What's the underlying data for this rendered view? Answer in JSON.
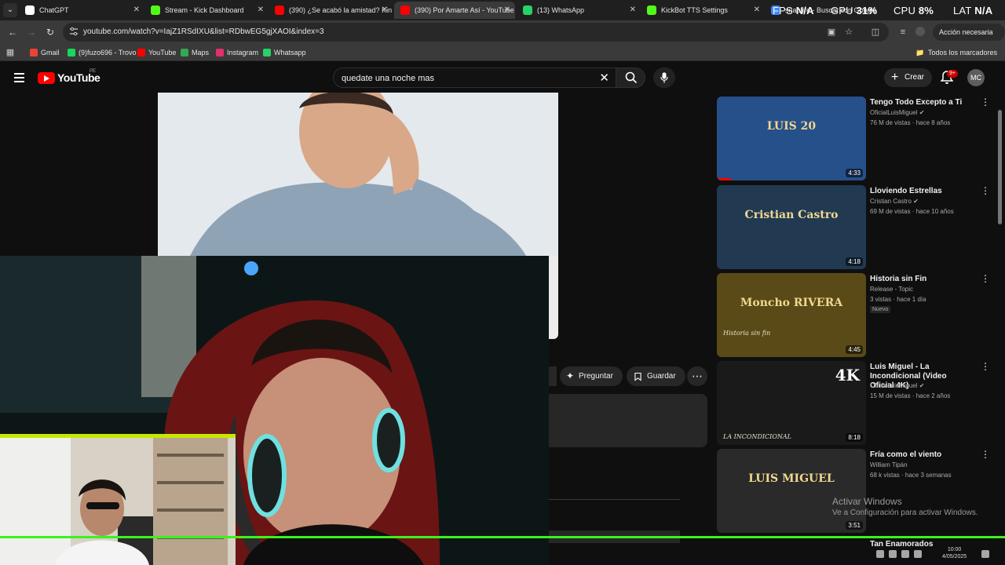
{
  "tabs": [
    {
      "title": "ChatGPT",
      "color": "#ffffff"
    },
    {
      "title": "Stream - Kick Dashboard",
      "color": "#53fc18"
    },
    {
      "title": "(390) ¿Se acabó la amistad? Kin",
      "color": "#ff0000"
    },
    {
      "title": "(390) Por Amarte Así - YouTube",
      "color": "#ff0000",
      "active": true
    },
    {
      "title": "(13) WhatsApp",
      "color": "#25d366"
    },
    {
      "title": "KickBot TTS Settings",
      "color": "#53fc18"
    },
    {
      "title": "snapfire - Buscar con Google",
      "color": "#4285f4"
    }
  ],
  "perf": {
    "fps_label": "FPS",
    "fps_value": "N/A",
    "gpu_label": "GPU",
    "gpu_value": "31%",
    "cpu_label": "CPU",
    "cpu_value": "8%",
    "lat_label": "LAT",
    "lat_value": "N/A"
  },
  "address": {
    "url": "youtube.com/watch?v=IajZ1RSdIXU&list=RDbwEG5gjXAOI&index=3",
    "action_label": "Acción necesaria"
  },
  "bookmarks": [
    {
      "label": "Gmail",
      "color": "#ea4335"
    },
    {
      "label": "(9)fuzo696 - Trovo",
      "color": "#19d65c"
    },
    {
      "label": "YouTube",
      "color": "#ff0000"
    },
    {
      "label": "Maps",
      "color": "#34a853"
    },
    {
      "label": "Instagram",
      "color": "#e1306c"
    },
    {
      "label": "Whatsapp",
      "color": "#25d366"
    }
  ],
  "bookmarks_all": "Todos los marcadores",
  "youtube": {
    "logo_text": "YouTube",
    "country": "PE",
    "search_query": "quedate una noche mas",
    "create_label": "Crear",
    "notif_badge": "9+",
    "avatar_initials": "MC"
  },
  "actions": {
    "ask_label": "Preguntar",
    "save_label": "Guardar"
  },
  "recommendations": [
    {
      "title": "Tengo Todo Excepto a Ti",
      "channel": "OficialLuisMiguel",
      "verified": true,
      "meta": "76 M de vistas · hace 8 años",
      "duration": "4:33",
      "thumb_bg": "#26508a",
      "thumb_text": "LUIS 20"
    },
    {
      "title": "Lloviendo Estrellas",
      "channel": "Cristian Castro",
      "verified": true,
      "meta": "69 M de vistas · hace 10 años",
      "duration": "4:18",
      "thumb_bg": "#213a52",
      "thumb_text": "Cristian Castro"
    },
    {
      "title": "Historia sin Fin",
      "channel": "Release - Topic",
      "verified": false,
      "meta": "3 vistas · hace 1 día",
      "badge": "Nuevo",
      "duration": "4:45",
      "thumb_bg": "#5a4a18",
      "thumb_text": "Moncho RIVERA",
      "thumb_sub": "Historia sin fin"
    },
    {
      "title": "Luis Miguel - La Incondicional (Video Oficial 4K)",
      "channel": "OficialLuisMiguel",
      "verified": true,
      "meta": "15 M de vistas · hace 2 años",
      "duration": "8:18",
      "thumb_bg": "#1a1a1a",
      "thumb_text": "4K",
      "thumb_sub": "LA INCONDICIONAL"
    },
    {
      "title": "Fría como el viento",
      "channel": "William Tipán",
      "verified": false,
      "meta": "68 k vistas · hace 3 semanas",
      "duration": "3:51",
      "thumb_bg": "#2a2a2a",
      "thumb_text": "LUIS MIGUEL"
    }
  ],
  "next_title": "Tan Enamorados",
  "windows": {
    "activate_title": "Activar Windows",
    "activate_sub": "Ve a Configuración para activar Windows."
  },
  "clock": {
    "time": "10:00",
    "date": "4/05/2025"
  }
}
